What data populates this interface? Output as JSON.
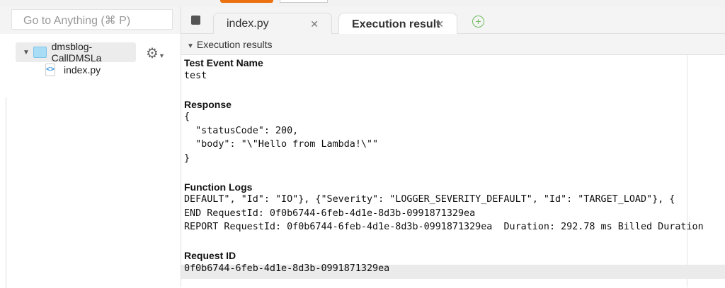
{
  "search": {
    "placeholder": "Go to Anything (⌘ P)"
  },
  "tree": {
    "folder": "dmsblog-CallDMSLa",
    "file": "index.py"
  },
  "tabs": [
    {
      "label": "index.py"
    },
    {
      "label": "Execution results"
    }
  ],
  "section": {
    "title": "Execution results"
  },
  "results": {
    "test_event_label": "Test Event Name",
    "test_event": "test",
    "response_label": "Response",
    "response_lines": [
      "{",
      "  \"statusCode\": 200,",
      "  \"body\": \"\\\"Hello from Lambda!\\\"\"",
      "}"
    ],
    "logs_label": "Function Logs",
    "log_lines": [
      "DEFAULT\", \"Id\": \"IO\"}, {\"Severity\": \"LOGGER_SEVERITY_DEFAULT\", \"Id\": \"TARGET_LOAD\"}, {",
      "END RequestId: 0f0b6744-6feb-4d1e-8d3b-0991871329ea",
      "REPORT RequestId: 0f0b6744-6feb-4d1e-8d3b-0991871329ea  Duration: 292.78 ms Billed Duration"
    ],
    "request_id_label": "Request ID",
    "request_id": "0f0b6744-6feb-4d1e-8d3b-0991871329ea"
  }
}
